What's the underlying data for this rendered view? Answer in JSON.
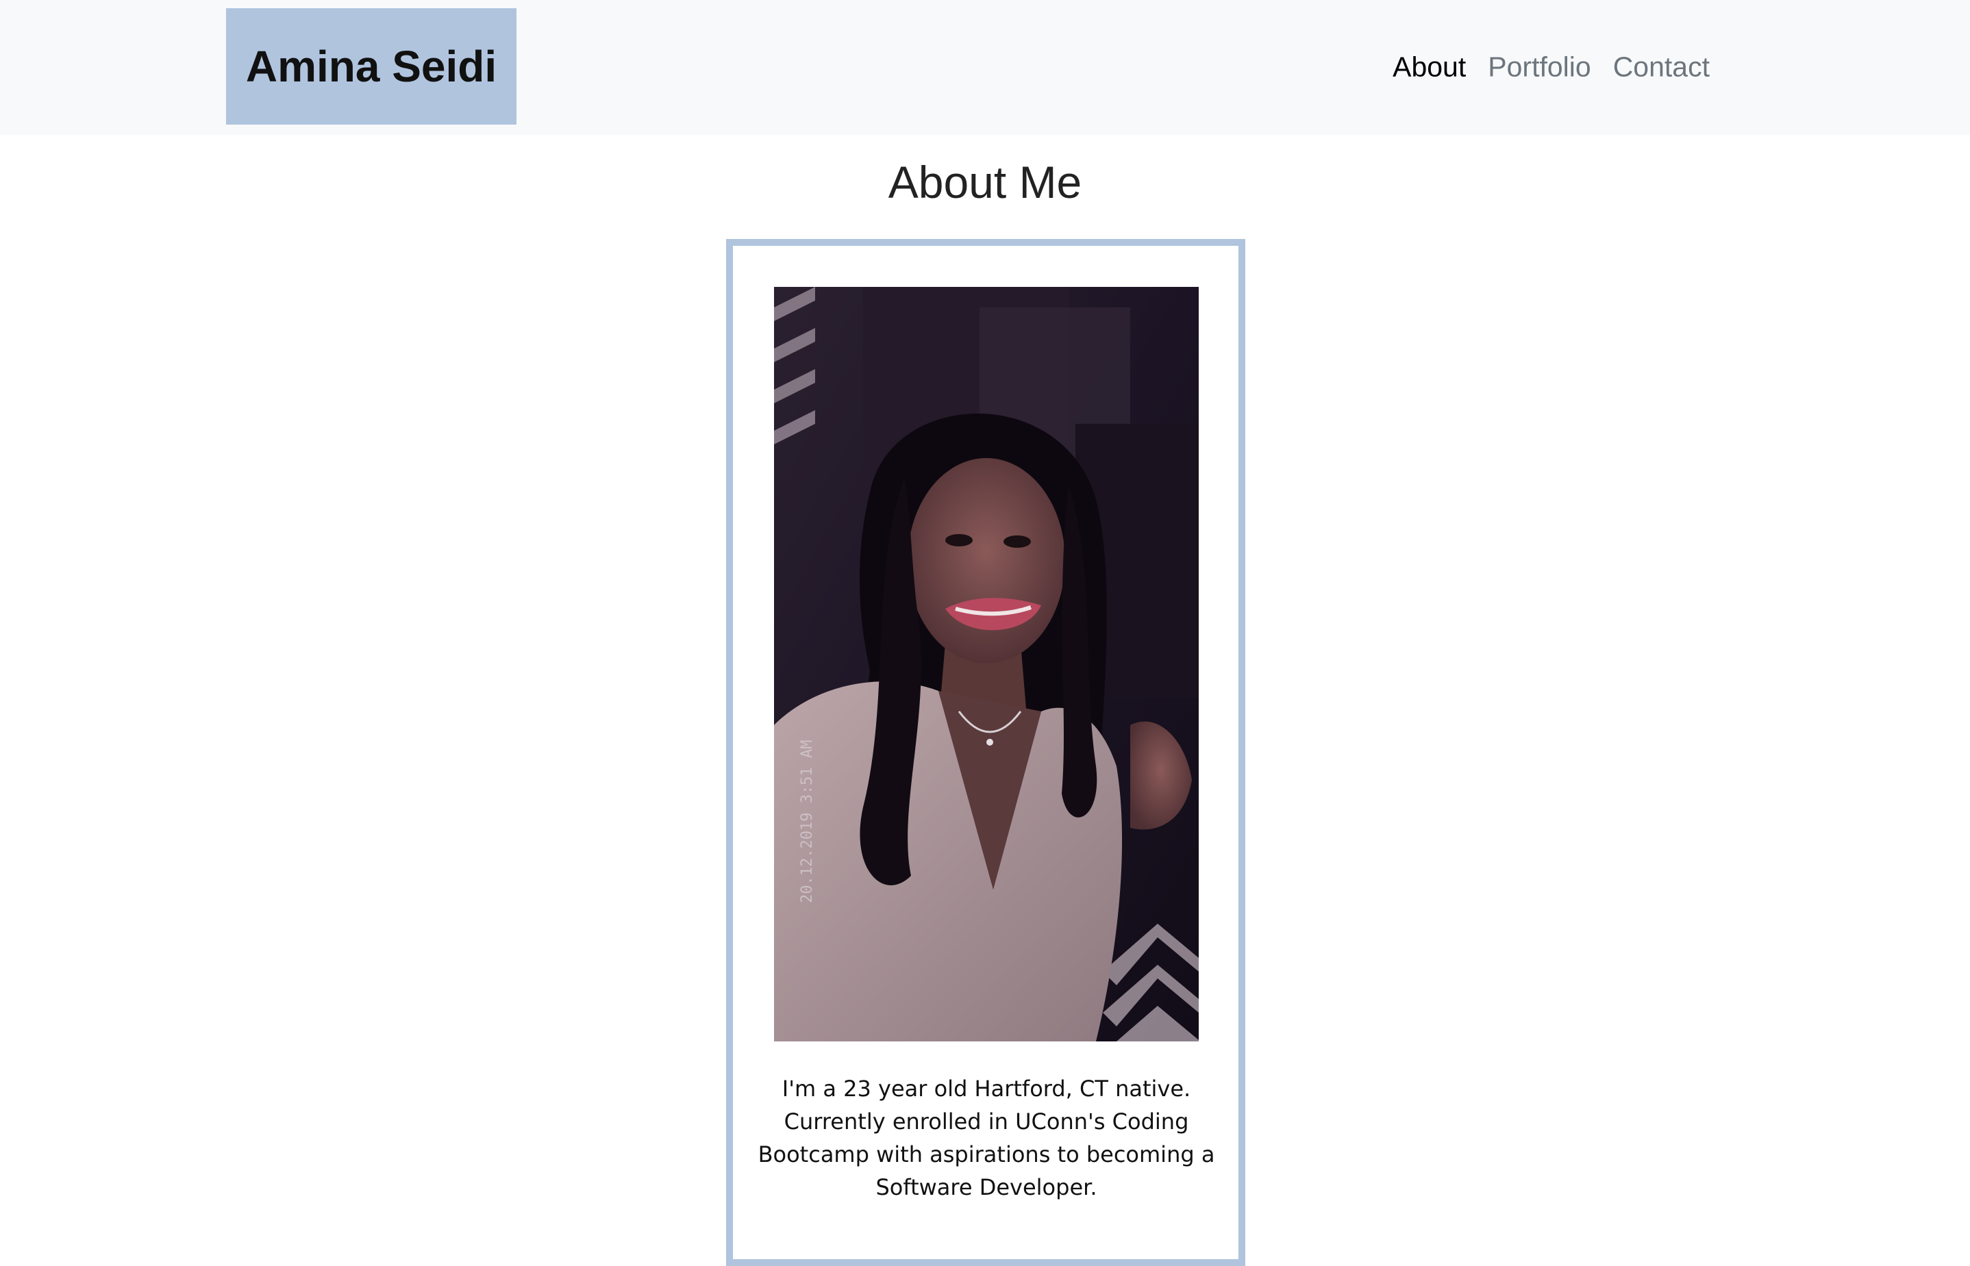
{
  "navbar": {
    "brand": "Amina Seidi",
    "links": [
      {
        "label": "About",
        "active": true
      },
      {
        "label": "Portfolio",
        "active": false
      },
      {
        "label": "Contact",
        "active": false
      }
    ]
  },
  "main": {
    "title": "About Me",
    "photo": {
      "timestamp": "20.12.2019  3:51 AM"
    },
    "bio": "I'm a 23 year old Hartford, CT native. Currently enrolled in UConn's Coding Bootcamp with aspirations to becoming a Software Developer."
  },
  "colors": {
    "accent": "#b0c4de",
    "navbar_bg": "#f8f9fa",
    "link_inactive": "#6c757d",
    "link_active": "#000000"
  }
}
